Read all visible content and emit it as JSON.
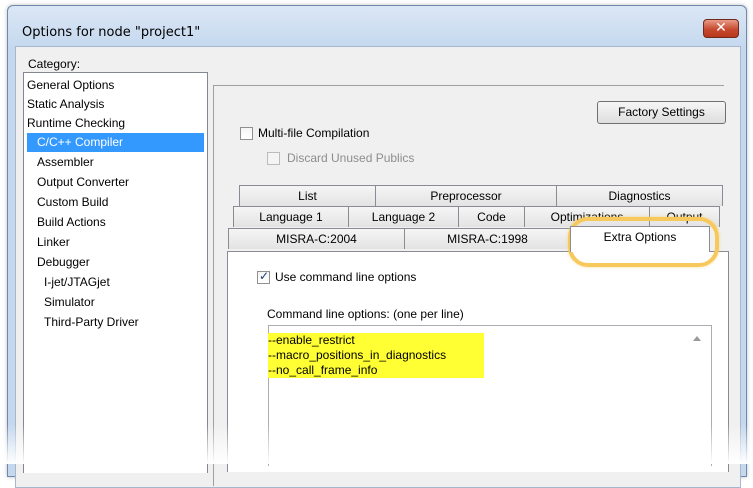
{
  "window": {
    "title": "Options for node \"project1\"",
    "close_icon": "close-icon",
    "close_glyph": "✕"
  },
  "category": {
    "label": "Category:",
    "items": [
      {
        "label": "General Options",
        "indent": false,
        "selected": false
      },
      {
        "label": "Static Analysis",
        "indent": false,
        "selected": false
      },
      {
        "label": "Runtime Checking",
        "indent": false,
        "selected": false
      },
      {
        "label": "C/C++ Compiler",
        "indent": true,
        "selected": true
      },
      {
        "label": "Assembler",
        "indent": true,
        "selected": false
      },
      {
        "label": "Output Converter",
        "indent": true,
        "selected": false
      },
      {
        "label": "Custom Build",
        "indent": true,
        "selected": false
      },
      {
        "label": "Build Actions",
        "indent": true,
        "selected": false
      },
      {
        "label": "Linker",
        "indent": true,
        "selected": false
      },
      {
        "label": "Debugger",
        "indent": true,
        "selected": false
      },
      {
        "label": "I-jet/JTAGjet",
        "indent": "sub",
        "selected": false
      },
      {
        "label": "Simulator",
        "indent": "sub",
        "selected": false
      },
      {
        "label": "Third-Party Driver",
        "indent": "sub",
        "selected": false
      }
    ]
  },
  "options": {
    "factory_settings": "Factory Settings",
    "multi_file": {
      "label": "Multi-file Compilation",
      "checked": false
    },
    "discard_unused": {
      "label": "Discard Unused Publics",
      "checked": false,
      "disabled": true
    },
    "tabs_row1": [
      "List",
      "Preprocessor",
      "Diagnostics"
    ],
    "tabs_row2": [
      "Language 1",
      "Language 2",
      "Code",
      "Optimizations",
      "Output"
    ],
    "tabs_row3": [
      "MISRA-C:2004",
      "MISRA-C:1998",
      "Extra Options"
    ],
    "active_tab": "Extra Options",
    "use_cmd": {
      "label": "Use command line options",
      "checked": true
    },
    "cmd_label": "Command line options:  (one per line)",
    "cmd_lines": [
      "--enable_restrict",
      "--macro_positions_in_diagnostics",
      "--no_call_frame_info"
    ]
  },
  "colors": {
    "selection": "#3399ff",
    "highlight_text": "#ffff33",
    "callout_ring": "#f7c95c"
  }
}
